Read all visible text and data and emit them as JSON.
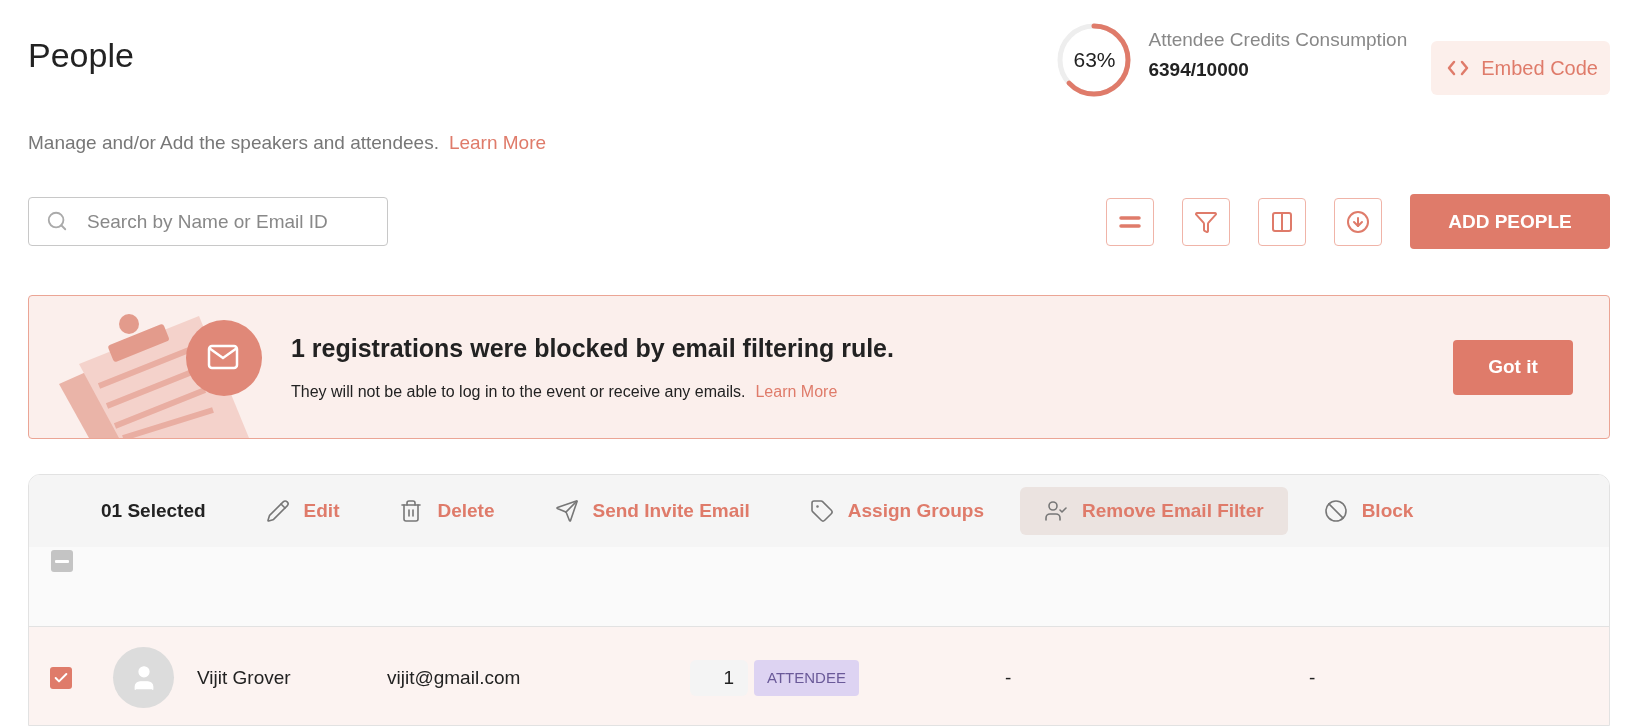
{
  "page": {
    "title": "People",
    "subtitle": "Manage and/or Add the speakers and attendees.",
    "subtitle_link": "Learn More"
  },
  "credits": {
    "percent": "63%",
    "level": 0.63,
    "label": "Attendee Credits Consumption",
    "value": "6394/10000"
  },
  "embed_button": "Embed Code",
  "search": {
    "placeholder": "Search by Name or Email ID"
  },
  "toolbar": [
    {
      "kind": "density"
    },
    {
      "kind": "filter"
    },
    {
      "kind": "columns"
    },
    {
      "kind": "download"
    }
  ],
  "add_button": "ADD PEOPLE",
  "banner": {
    "title": "1 registrations were blocked by email filtering rule.",
    "text": "They will not be able to log in to the event or receive any emails.",
    "link": "Learn More",
    "button": "Got it"
  },
  "table": {
    "selection_count": "01 Selected",
    "select_all_indeterminate": true,
    "actions": [
      {
        "kind": "edit",
        "label": "Edit",
        "selected": false
      },
      {
        "kind": "delete",
        "label": "Delete",
        "selected": false
      },
      {
        "kind": "send",
        "label": "Send Invite Email",
        "selected": false
      },
      {
        "kind": "tag",
        "label": "Assign Groups",
        "selected": false
      },
      {
        "kind": "user-check",
        "label": "Remove Email Filter",
        "selected": true
      },
      {
        "kind": "block",
        "label": "Block",
        "selected": false
      }
    ],
    "rows": [
      {
        "checked": true,
        "name": "Vijit Grover",
        "email": "vijit@gmail.com",
        "group_count": "1",
        "group_tag": "ATTENDEE",
        "column_4": "-",
        "column_5": "-"
      }
    ]
  }
}
